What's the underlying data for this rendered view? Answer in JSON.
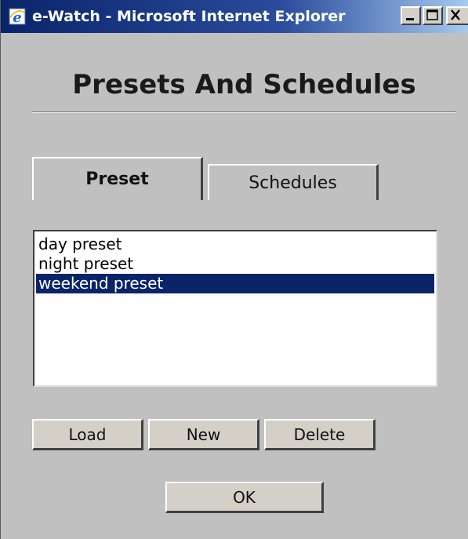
{
  "window": {
    "title": "e-Watch - Microsoft Internet Explorer",
    "app_icon": "ie-icon",
    "controls": [
      "minimize-icon",
      "maximize-icon",
      "close-icon"
    ]
  },
  "dialog": {
    "heading": "Presets And Schedules"
  },
  "tabs": [
    {
      "label": "Preset",
      "active": true
    },
    {
      "label": "Schedules",
      "active": false
    }
  ],
  "presets": {
    "items": [
      "day preset",
      "night preset",
      "weekend preset"
    ],
    "selected": "weekend preset"
  },
  "actions": {
    "load_label": "Load",
    "new_label": "New",
    "delete_label": "Delete",
    "ok_label": "OK"
  },
  "colors": {
    "titlebar": "#0a246a",
    "selection": "#0a246a",
    "face": "#c0c0c0"
  }
}
